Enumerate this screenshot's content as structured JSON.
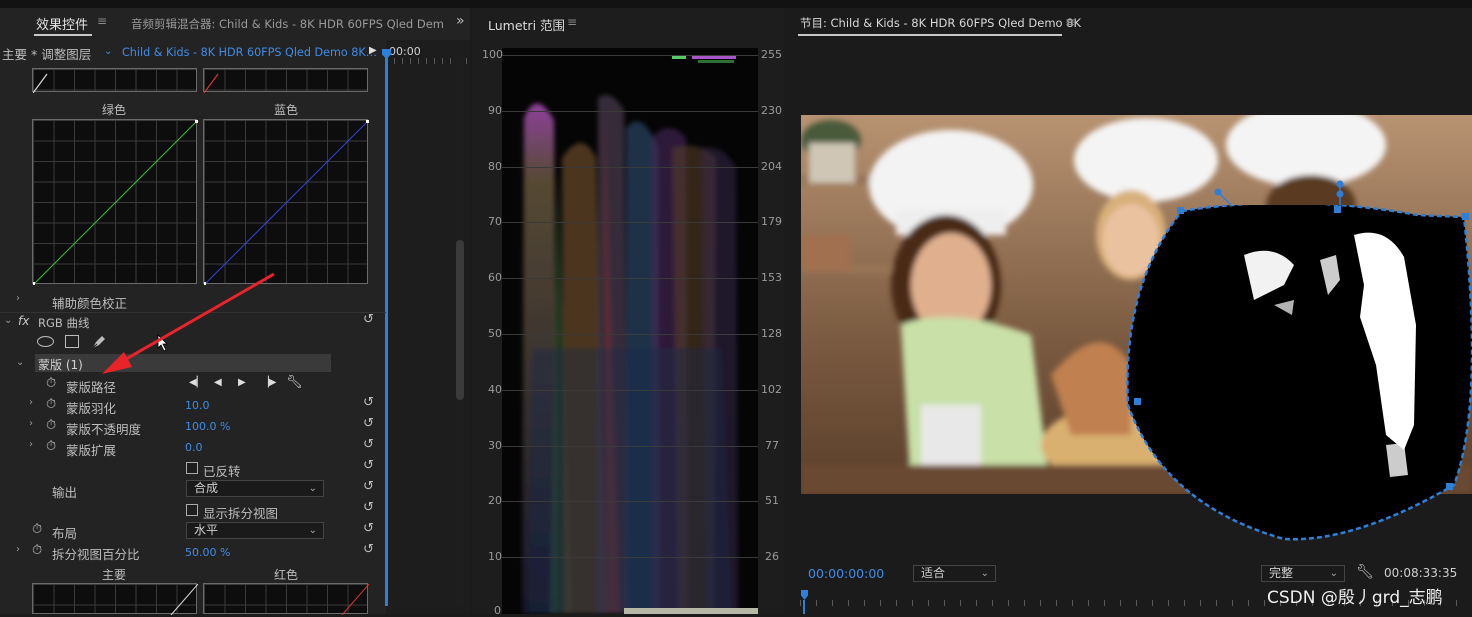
{
  "effect_controls": {
    "tab_label": "效果控件",
    "menu_icon": "hamburger-icon",
    "audio_mixer_tab": "音频剪辑混合器: Child & Kids - 8K HDR 60FPS Qled Dem",
    "overflow": "»",
    "master_label": "主要 * 调整图层",
    "clip_name": "Child & Kids - 8K HDR 60FPS Qled Demo 8K…",
    "timecode": "00:00",
    "curves": {
      "green": "绿色",
      "blue": "蓝色",
      "master": "主要",
      "red": "红色"
    },
    "secondary_label": "辅助颜色校正",
    "fx_label": "fx",
    "effect_name": "RGB 曲线",
    "mask_label": "蒙版 (1)",
    "properties": [
      {
        "label": "蒙版路径"
      },
      {
        "label": "蒙版羽化",
        "value": "10.0"
      },
      {
        "label": "蒙版不透明度",
        "value": "100.0 %"
      },
      {
        "label": "蒙版扩展",
        "value": "0.0"
      },
      {
        "label": "已反转"
      },
      {
        "label": "输出",
        "value": "合成"
      },
      {
        "label": "显示拆分视图"
      },
      {
        "label": "布局",
        "value": "水平"
      },
      {
        "label": "拆分视图百分比",
        "value": "50.00 %"
      }
    ]
  },
  "lumetri": {
    "title": "Lumetri 范围",
    "left_ticks": [
      "100",
      "90",
      "80",
      "70",
      "60",
      "50",
      "40",
      "30",
      "20",
      "10",
      "0"
    ],
    "right_ticks": [
      "255",
      "230",
      "204",
      "179",
      "153",
      "128",
      "102",
      "77",
      "51",
      "26"
    ]
  },
  "program": {
    "title": "节目: Child & Kids - 8K HDR 60FPS Qled Demo 8K",
    "timecode": "00:00:00:00",
    "fit": "适合",
    "quality": "完整",
    "duration": "00:08:33:35"
  },
  "watermark": "CSDN @殷丿grd_志鹏",
  "colors": {
    "accent": "#2e7fd8",
    "value_blue": "#3f8ce8",
    "annotation_arrow": "#e8232a"
  }
}
